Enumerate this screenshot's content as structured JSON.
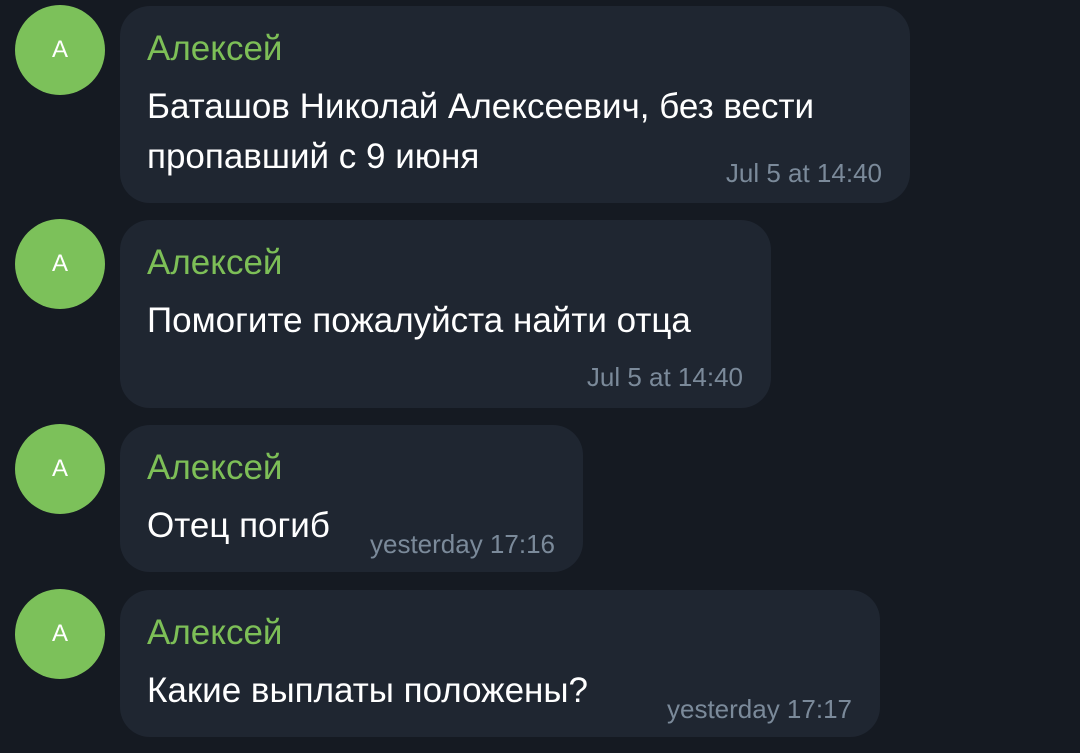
{
  "colors": {
    "background": "#151a22",
    "bubble": "#1f2631",
    "avatar": "#7cc15a",
    "sender_name": "#7dbf57",
    "text": "#ffffff",
    "timestamp": "#7b8a9a"
  },
  "messages": [
    {
      "avatar_letter": "А",
      "sender": "Алексей",
      "lines": [
        "Баташов Николай Алексеевич, без вести",
        "пропавший с 9 июня"
      ],
      "time": "Jul 5 at 14:40"
    },
    {
      "avatar_letter": "А",
      "sender": "Алексей",
      "lines": [
        "Помогите пожалуйста найти отца"
      ],
      "time": "Jul 5 at 14:40"
    },
    {
      "avatar_letter": "А",
      "sender": "Алексей",
      "lines": [
        "Отец погиб"
      ],
      "time": "yesterday 17:16"
    },
    {
      "avatar_letter": "А",
      "sender": "Алексей",
      "lines": [
        "Какие выплаты положены?"
      ],
      "time": "yesterday 17:17"
    }
  ]
}
